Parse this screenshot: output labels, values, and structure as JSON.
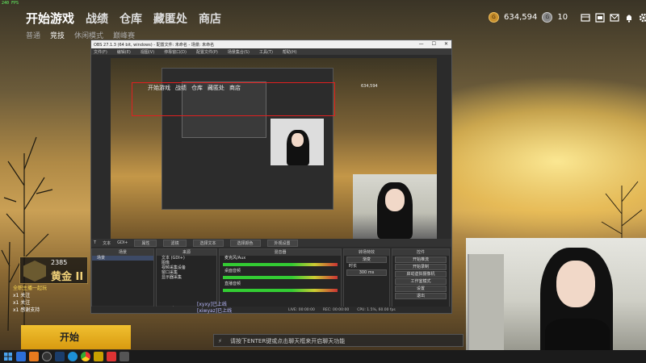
{
  "game": {
    "fps": "240 FPS",
    "nav": [
      "开始游戏",
      "战绩",
      "仓库",
      "藏匿处",
      "商店"
    ],
    "subnav": [
      "普通",
      "竞技",
      "休闲模式",
      "巅峰赛"
    ],
    "currency_gold": "634,594",
    "currency_silver": "10",
    "icons": [
      "store-icon",
      "inventory-icon",
      "mail-icon",
      "bell-icon",
      "gear-icon"
    ]
  },
  "obs": {
    "title": "OBS 27.1.3 (64 bit, windows) - 配置文件: 未命名 - 场景: 未命名",
    "menu": [
      "文件(F)",
      "编辑(E)",
      "视图(V)",
      "停靠窗口(D)",
      "配置文件(P)",
      "场景集合(S)",
      "工具(T)",
      "帮助(H)"
    ],
    "preview_nav": [
      "开始游戏",
      "战绩",
      "仓库",
      "藏匿处",
      "商店"
    ],
    "preview_currency": "634,594",
    "toolbar": {
      "text_label": "文本",
      "source_name": "GDI+",
      "props": "属性",
      "filters": "滤镜",
      "select_text": "选择文本",
      "select_color": "选择颜色",
      "extra": "外观设置"
    },
    "docks": {
      "scenes_title": "场景",
      "scenes": [
        "场景"
      ],
      "sources_title": "来源",
      "sources": [
        "文本 (GDI+)",
        "图像",
        "视频采集设备",
        "窗口采集",
        "显示器采集"
      ],
      "mixer_title": "混音器",
      "mixer": [
        "麦克风/Aux",
        "桌面音频",
        "直播音频"
      ],
      "transitions_title": "转场特效",
      "transition_type": "渐变",
      "duration_label": "时长",
      "duration_value": "300 ms",
      "controls_title": "控件",
      "controls": [
        "开始推流",
        "开始录制",
        "启动虚拟摄像机",
        "工作室模式",
        "设置",
        "退出"
      ]
    },
    "status": [
      "LIVE: 00:00:00",
      "REC: 00:00:00",
      "CPU: 1.5%, 60.00 fps"
    ]
  },
  "overlay": {
    "rank_points": "2385",
    "rank_tier": "黄金 II",
    "chat_lines": [
      {
        "text": "全职主播一起玩",
        "highlight": true
      },
      {
        "text": "x1 关注",
        "highlight": false
      },
      {
        "text": "x1 关注",
        "highlight": false
      },
      {
        "text": "x1 感谢支持",
        "highlight": false
      }
    ],
    "start_button": "开始",
    "danmu": [
      "[xyxy]已上线",
      "[xiwyaz]已上线"
    ],
    "chat_placeholder": "请按下ENTER键或点击聊天框来开启聊天功能"
  },
  "taskbar": {
    "icons": [
      "windows-icon",
      "app-icon",
      "game-icon",
      "obs-icon",
      "steam-icon",
      "edge-icon",
      "chrome-icon",
      "wegame-icon",
      "app2-icon",
      "app3-icon"
    ]
  }
}
